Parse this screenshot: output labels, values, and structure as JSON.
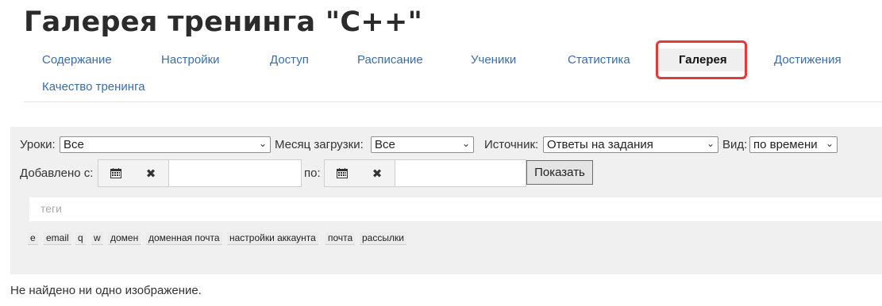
{
  "page": {
    "title": "Галерея тренинга \"С++\"",
    "empty_message": "Не найдено ни одно изображение."
  },
  "tabs": [
    {
      "label": "Содержание"
    },
    {
      "label": "Настройки"
    },
    {
      "label": "Доступ"
    },
    {
      "label": "Расписание"
    },
    {
      "label": "Ученики"
    },
    {
      "label": "Статистика"
    },
    {
      "label": "Галерея",
      "active": true
    },
    {
      "label": "Достижения"
    },
    {
      "label": "Качество тренинга"
    }
  ],
  "filters": {
    "lessons_label": "Уроки:",
    "lessons_value": "Все",
    "month_label": "Месяц загрузки:",
    "month_value": "Все",
    "source_label": "Источник:",
    "source_value": "Ответы на задания",
    "view_label": "Вид:",
    "view_value": "по времени",
    "added_from_label": "Добавлено с:",
    "to_label": "по:",
    "show_button": "Показать",
    "tags_placeholder": "теги",
    "calendar_icon": "calendar-icon",
    "clear_icon": "✖"
  },
  "tags": [
    "e",
    "email",
    "q",
    "w",
    "домен",
    "доменная почта",
    "настройки аккаунта",
    "почта",
    "рассылки"
  ],
  "colors": {
    "highlight": "#e03a3a",
    "link": "#3a6ea8"
  }
}
